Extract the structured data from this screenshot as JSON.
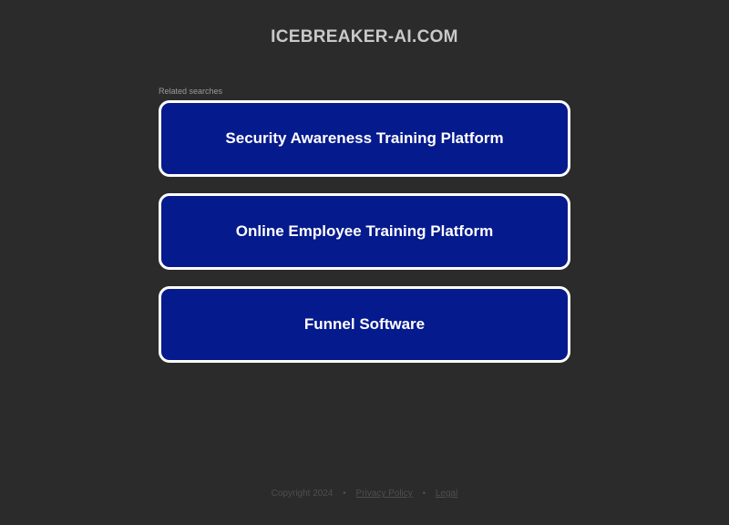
{
  "header": {
    "domain": "ICEBREAKER-AI.COM"
  },
  "related": {
    "label": "Related searches",
    "items": [
      {
        "label": "Security Awareness Training Platform"
      },
      {
        "label": "Online Employee Training Platform"
      },
      {
        "label": "Funnel Software"
      }
    ]
  },
  "footer": {
    "copyright": "Copyright 2024",
    "separator": "•",
    "privacy_label": "Privacy Policy",
    "legal_label": "Legal"
  },
  "colors": {
    "background": "#2b2b2b",
    "button_fill": "#051a8c",
    "button_border": "#ffffff",
    "title_text": "#c9c9c9"
  }
}
